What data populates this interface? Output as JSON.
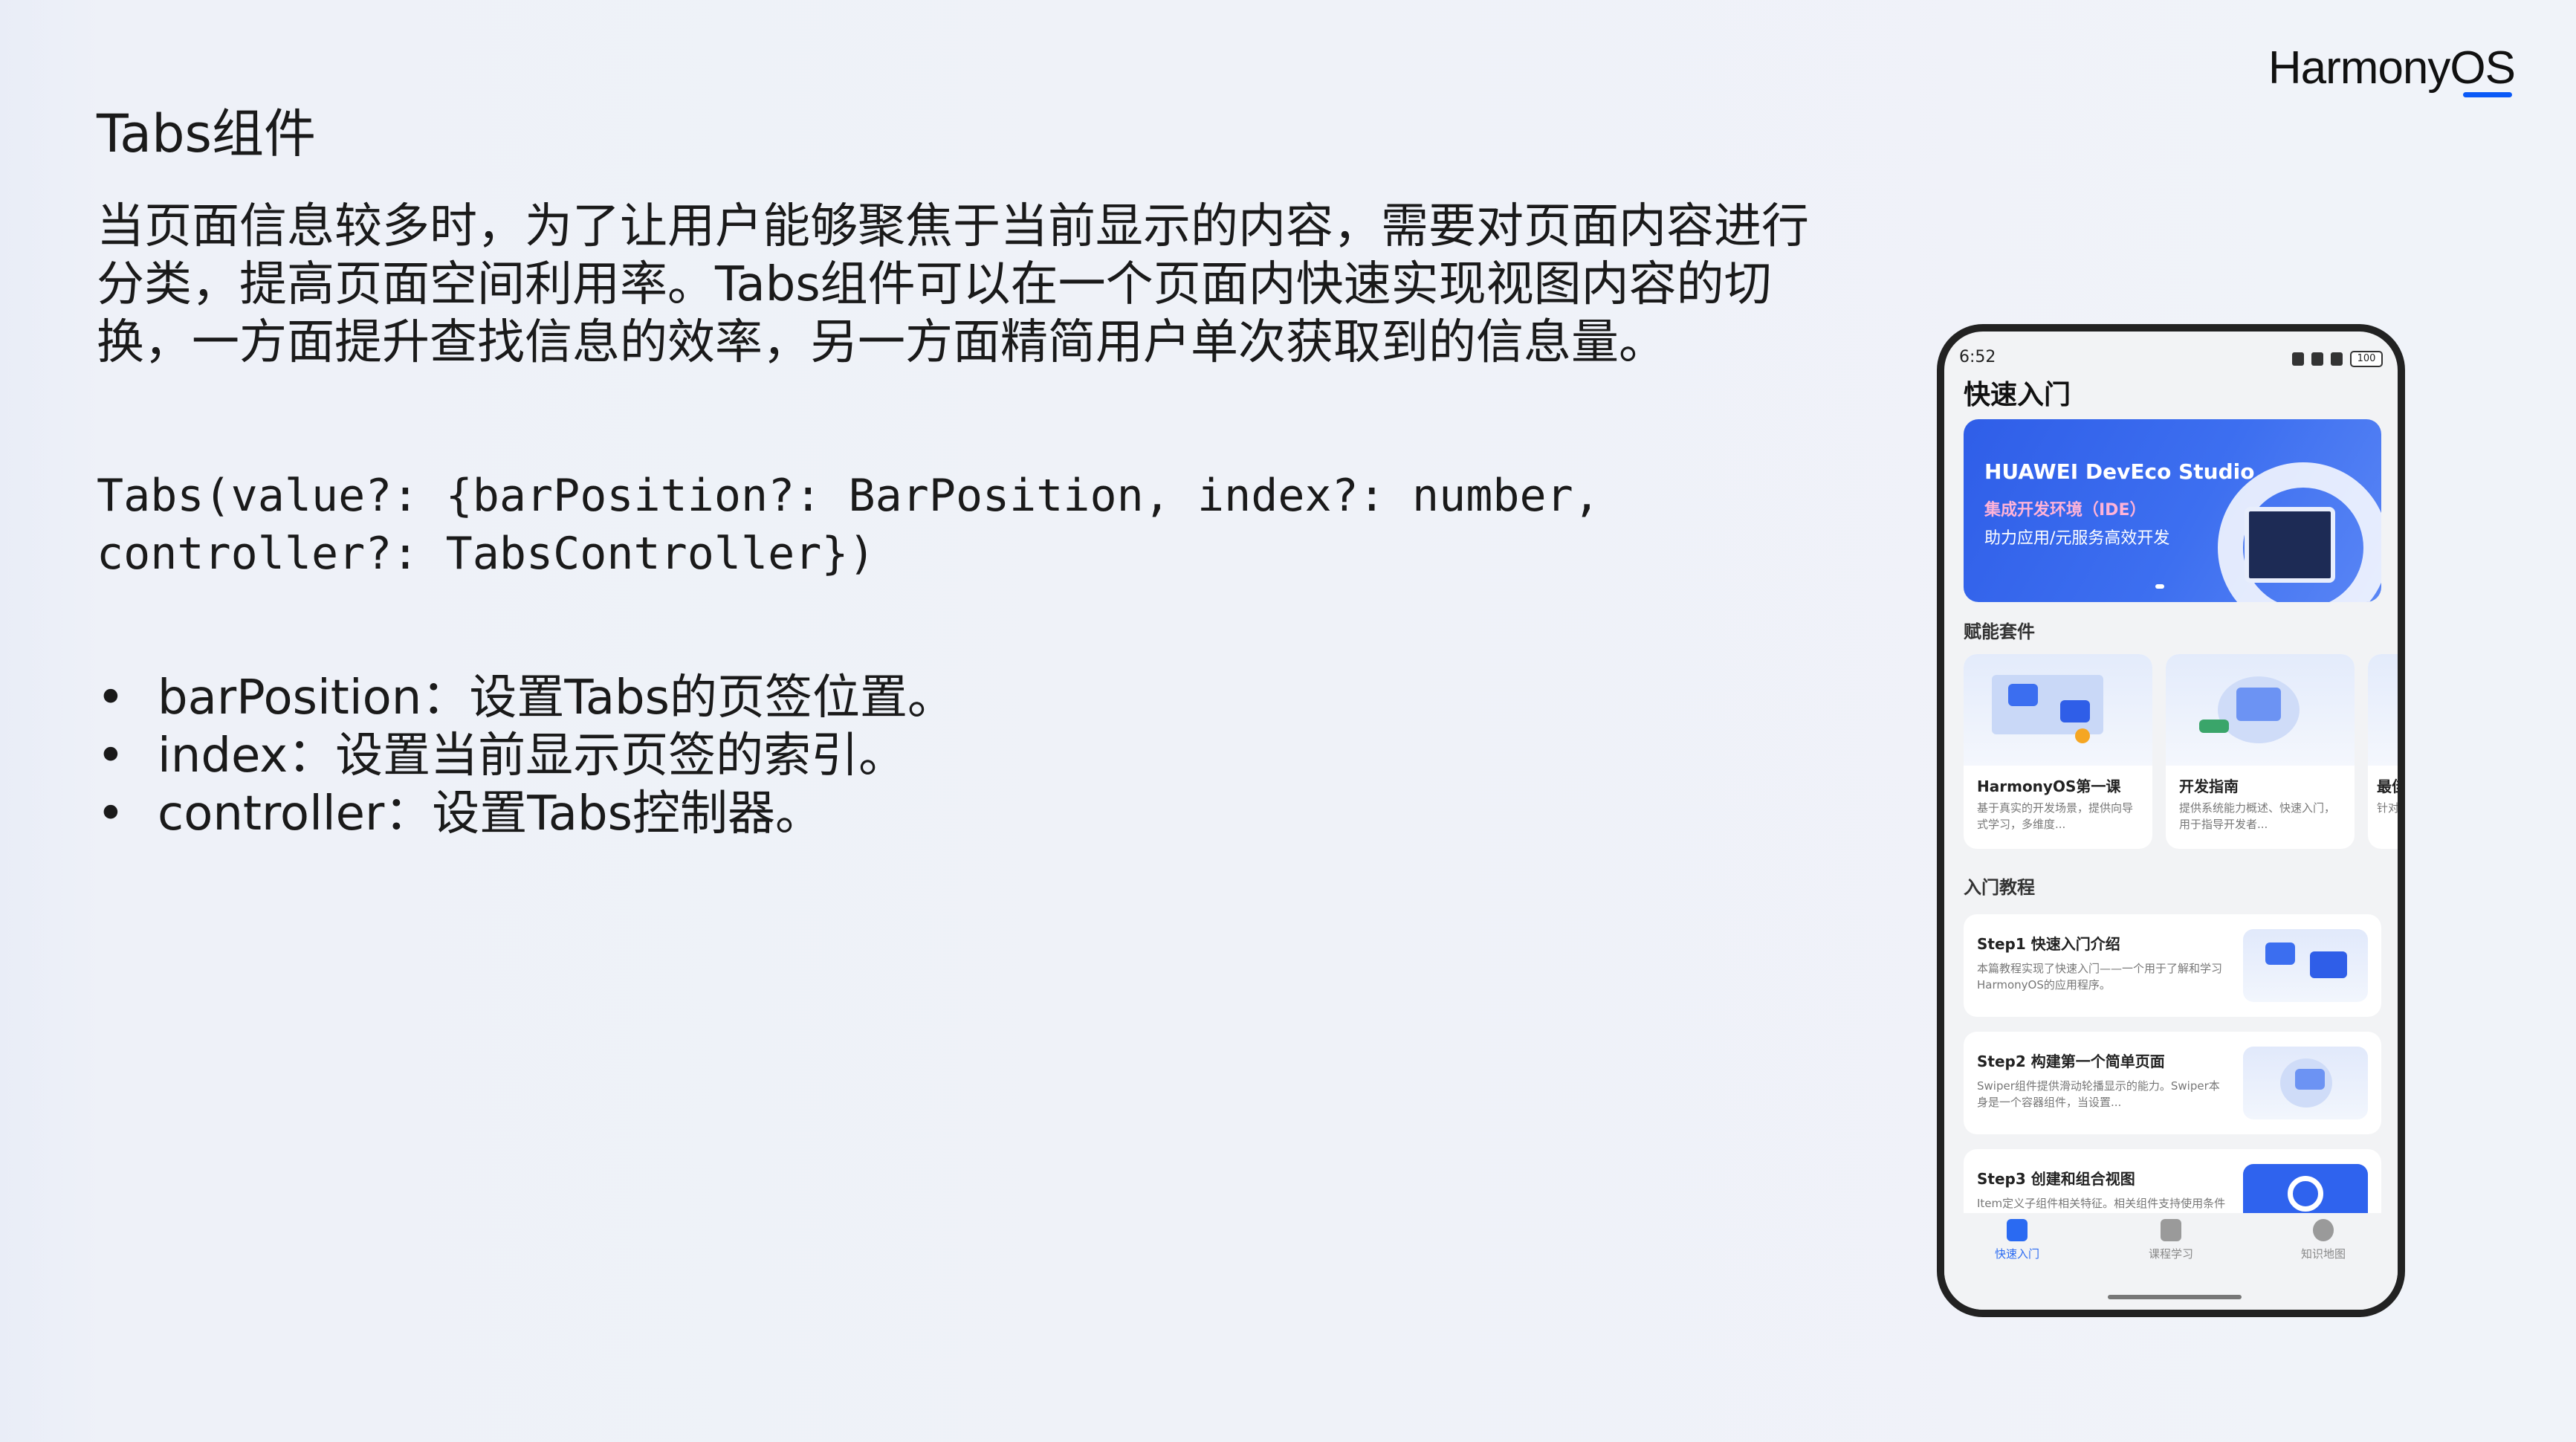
{
  "brand": {
    "harmony": "Harmony",
    "os": "OS"
  },
  "slide": {
    "title": "Tabs组件",
    "description": "当页面信息较多时，为了让用户能够聚焦于当前显示的内容，需要对页面内容进行分类，提高页面空间利用率。Tabs组件可以在一个页面内快速实现视图内容的切换，一方面提升查找信息的效率，另一方面精简用户单次获取到的信息量。",
    "code": "Tabs(value?: {barPosition?: BarPosition, index?: number,\ncontroller?: TabsController})",
    "bullets": [
      "barPosition：设置Tabs的页签位置。",
      "index：设置当前显示页签的索引。",
      "controller：设置Tabs控制器。"
    ]
  },
  "phone": {
    "status_time": "6:52",
    "battery": "100",
    "app_title": "快速入门",
    "banner": {
      "title": "HUAWEI DevEco Studio",
      "subtitle1": "集成开发环境（IDE）",
      "subtitle2": "助力应用/元服务高效开发"
    },
    "section_kits": "赋能套件",
    "kits": [
      {
        "name": "HarmonyOS第一课",
        "text": "基于真实的开发场景，提供向导式学习，多维度..."
      },
      {
        "name": "开发指南",
        "text": "提供系统能力概述、快速入门，用于指导开发者..."
      },
      {
        "name": "最佳",
        "text": "针对性能"
      }
    ],
    "section_tutorial": "入门教程",
    "steps": [
      {
        "title": "Step1 快速入门介绍",
        "text": "本篇教程实现了快速入门——一个用于了解和学习HarmonyOS的应用程序。"
      },
      {
        "title": "Step2 构建第一个简单页面",
        "text": "Swiper组件提供滑动轮播显示的能力。Swiper本身是一个容器组件，当设置..."
      },
      {
        "title": "Step3 创建和组合视图",
        "text": "Item定义子组件相关特征。相关组件支持使用条件渲染、循环渲染、懒加载..."
      }
    ],
    "tabs": [
      "快速入门",
      "课程学习",
      "知识地图"
    ],
    "accent": "#2a6af2"
  }
}
